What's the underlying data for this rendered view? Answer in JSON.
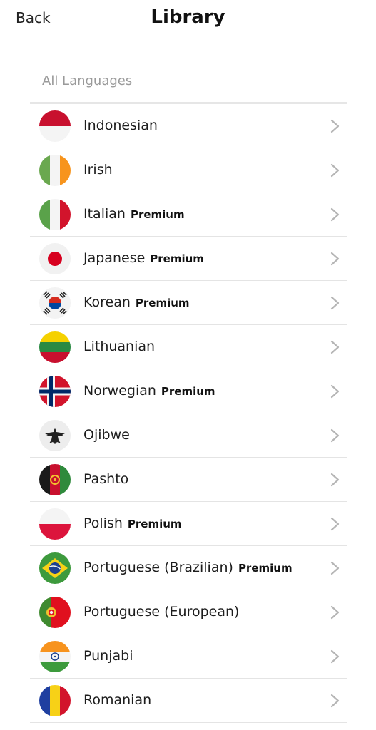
{
  "header": {
    "back_label": "Back",
    "title": "Library"
  },
  "section_label": "All Languages",
  "premium_label": "Premium",
  "languages": [
    {
      "name": "Indonesian",
      "premium": false,
      "flag_icon": "indonesia-flag-icon"
    },
    {
      "name": "Irish",
      "premium": false,
      "flag_icon": "ireland-flag-icon"
    },
    {
      "name": "Italian",
      "premium": true,
      "flag_icon": "italy-flag-icon"
    },
    {
      "name": "Japanese",
      "premium": true,
      "flag_icon": "japan-flag-icon"
    },
    {
      "name": "Korean",
      "premium": true,
      "flag_icon": "south-korea-flag-icon"
    },
    {
      "name": "Lithuanian",
      "premium": false,
      "flag_icon": "lithuania-flag-icon"
    },
    {
      "name": "Norwegian",
      "premium": true,
      "flag_icon": "norway-flag-icon"
    },
    {
      "name": "Ojibwe",
      "premium": false,
      "flag_icon": "ojibwe-thunderbird-icon"
    },
    {
      "name": "Pashto",
      "premium": false,
      "flag_icon": "afghanistan-flag-icon"
    },
    {
      "name": "Polish",
      "premium": true,
      "flag_icon": "poland-flag-icon"
    },
    {
      "name": "Portuguese (Brazilian)",
      "premium": true,
      "flag_icon": "brazil-flag-icon"
    },
    {
      "name": "Portuguese (European)",
      "premium": false,
      "flag_icon": "portugal-flag-icon"
    },
    {
      "name": "Punjabi",
      "premium": false,
      "flag_icon": "india-flag-icon"
    },
    {
      "name": "Romanian",
      "premium": false,
      "flag_icon": "romania-flag-icon"
    }
  ],
  "colors": {
    "section_label": "#9a9a9a",
    "divider": "#e4e4e4",
    "chevron": "#b5b5b5"
  }
}
